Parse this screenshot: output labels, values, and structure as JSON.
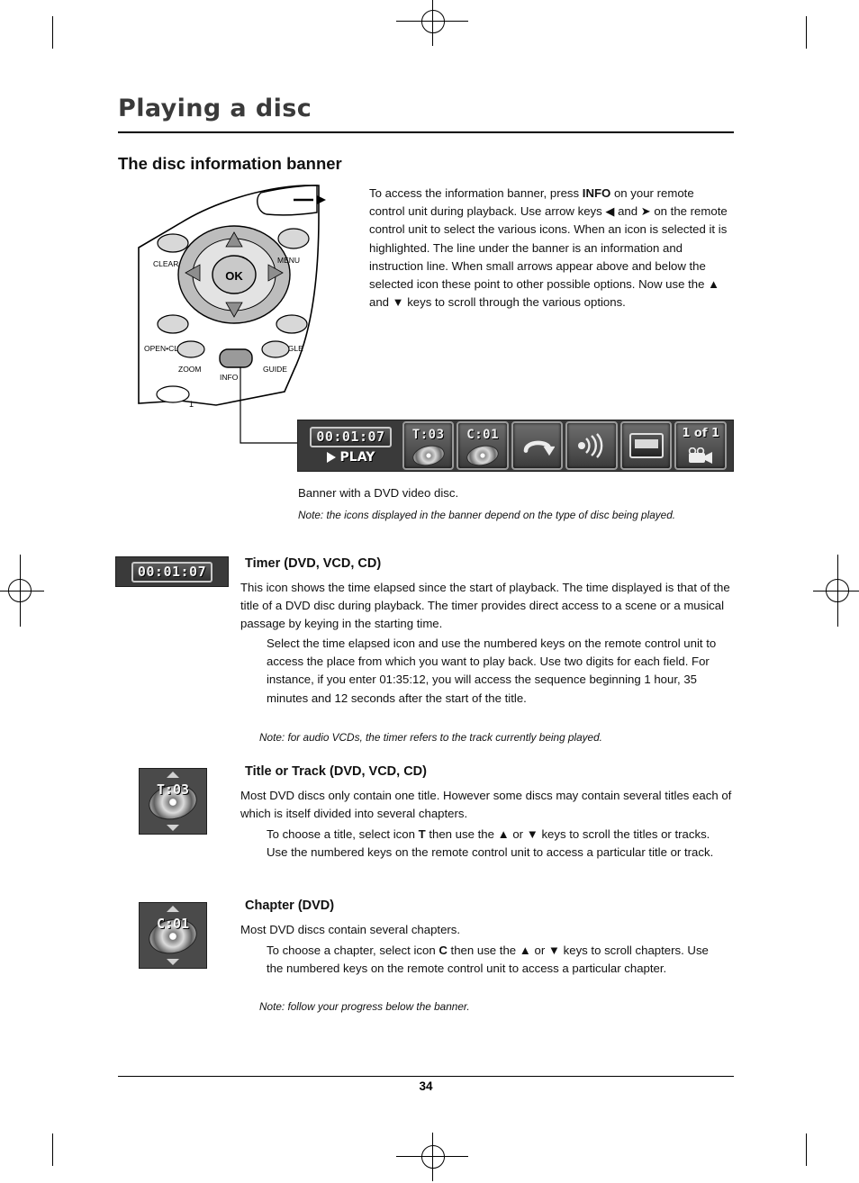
{
  "document": {
    "chapter_title": "Playing a disc",
    "section_title": "The disc information banner",
    "page_number": "34"
  },
  "intro": {
    "part1": "To access the information banner, press ",
    "info_key": "INFO",
    "part2": " on your remote control unit during playback. Use arrow keys ",
    "left_arrow": "◀",
    "and1": " and ",
    "right_arrow": "➤",
    "part3": " on the remote control unit to select the various icons. When an icon is selected it is highlighted. The line under the banner is an information and instruction line. When small arrows appear above and below the selected icon these point to other possible options. Now use the ",
    "up_arrow": "▲",
    "and2": " and ",
    "down_arrow": "▼",
    "part4": " keys to scroll through the various options."
  },
  "remote": {
    "clear": "CLEAR",
    "menu": "MENU",
    "ok": "OK",
    "open_close": "OPEN•CLOSE",
    "angle": "ANGLE",
    "zoom": "ZOOM",
    "guide": "GUIDE",
    "info": "INFO",
    "one": "1"
  },
  "banner": {
    "time": "00:01:07",
    "play_label": "PLAY",
    "title_label": "T:03",
    "chapter_label": "C:01",
    "repeat_icon": "repeat-icon",
    "sound_icon": "audio-icon",
    "subtitle_icon": "subtitle-icon",
    "angle_label": "1 of 1",
    "camera_icon": "camera-icon",
    "caption": "Banner with a DVD video disc.",
    "note": "Note: the icons displayed in the banner depend on the type of disc being played."
  },
  "timer_section": {
    "icon_time": "00:01:07",
    "heading": "Timer (DVD, VCD, CD)",
    "paragraph": "This icon shows the time elapsed since the start of playback. The time displayed is that of the title of a DVD disc during playback. The timer provides direct access to a scene or a musical passage by keying in the starting time.",
    "indent": "Select the time elapsed icon and use the numbered keys on the remote control unit to access the place from which you want to play back. Use two digits for each field. For instance, if you enter 01:35:12, you will access the sequence beginning 1 hour, 35 minutes and 12 seconds after the start of the title.",
    "note": "Note: for audio VCDs, the timer refers to the track currently being played."
  },
  "title_section": {
    "icon_label": "T:03",
    "heading": "Title or Track (DVD, VCD, CD)",
    "paragraph": "Most DVD discs only contain one title. However some discs may contain several titles each of which is itself divided into several chapters.",
    "indent_part1": "To choose a title, select icon ",
    "indent_bold": "T",
    "indent_part2": " then use the ",
    "up_arrow": "▲",
    "or": " or ",
    "down_arrow": "▼",
    "indent_part3": " keys to scroll the titles or tracks. Use the numbered keys on the remote control unit to access a particular title or track."
  },
  "chapter_section": {
    "icon_label": "C:01",
    "heading": "Chapter (DVD)",
    "paragraph": "Most DVD discs contain several chapters.",
    "indent_part1": "To choose a chapter, select icon ",
    "indent_bold": "C",
    "indent_part2": " then use the ",
    "up_arrow": "▲",
    "or": " or ",
    "down_arrow": "▼",
    "indent_part3": " keys to scroll chapters. Use the numbered keys on the remote control unit to access a particular chapter.",
    "note": "Note: follow your progress below the banner."
  }
}
